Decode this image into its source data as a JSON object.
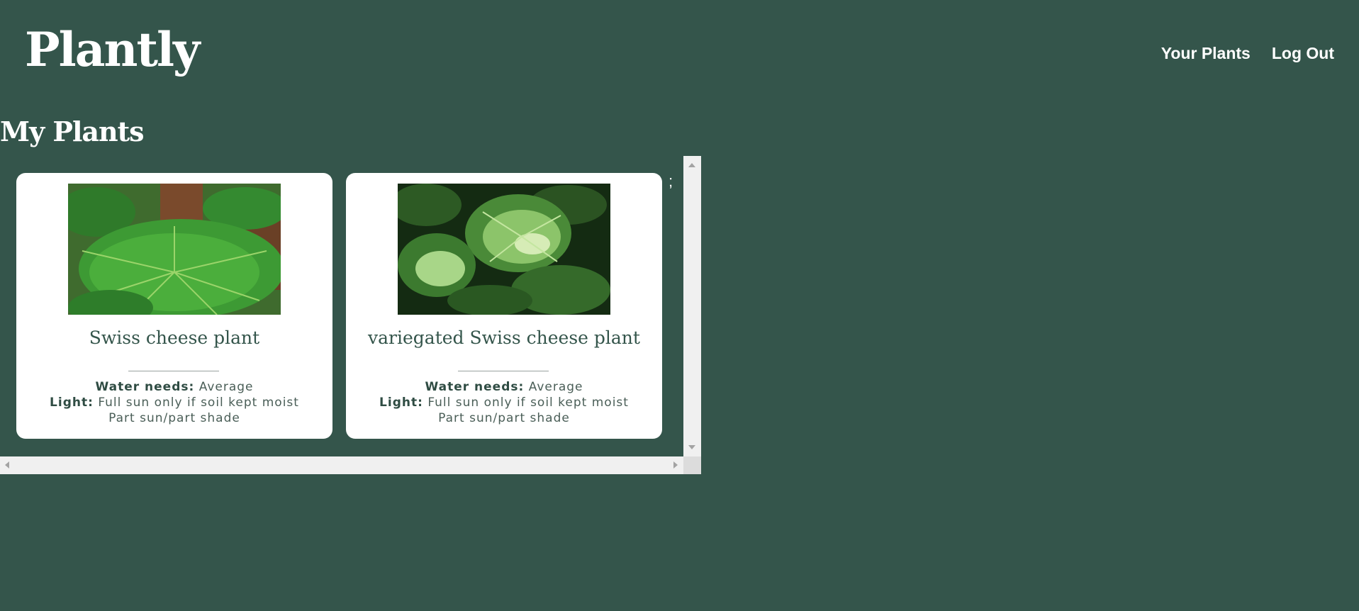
{
  "brand": {
    "title": "Plantly"
  },
  "nav": {
    "items": [
      {
        "label": "Your Plants"
      },
      {
        "label": "Log Out"
      }
    ]
  },
  "page": {
    "title": "My Plants",
    "stray_text": ";"
  },
  "labels": {
    "water": "Water needs:",
    "light": "Light:"
  },
  "plants": [
    {
      "name": "Swiss cheese plant",
      "water": "Average",
      "light": "Full sun only if soil kept moist",
      "light_extra": "Part sun/part shade",
      "image_icon": "monstera-photo"
    },
    {
      "name": "variegated Swiss cheese plant",
      "water": "Average",
      "light": "Full sun only if soil kept moist",
      "light_extra": "Part sun/part shade",
      "image_icon": "variegated-monstera-photo"
    }
  ],
  "colors": {
    "background": "#34554b",
    "card": "#ffffff",
    "accent_text": "#34554b",
    "scrollbar": "#f0f0f0"
  }
}
